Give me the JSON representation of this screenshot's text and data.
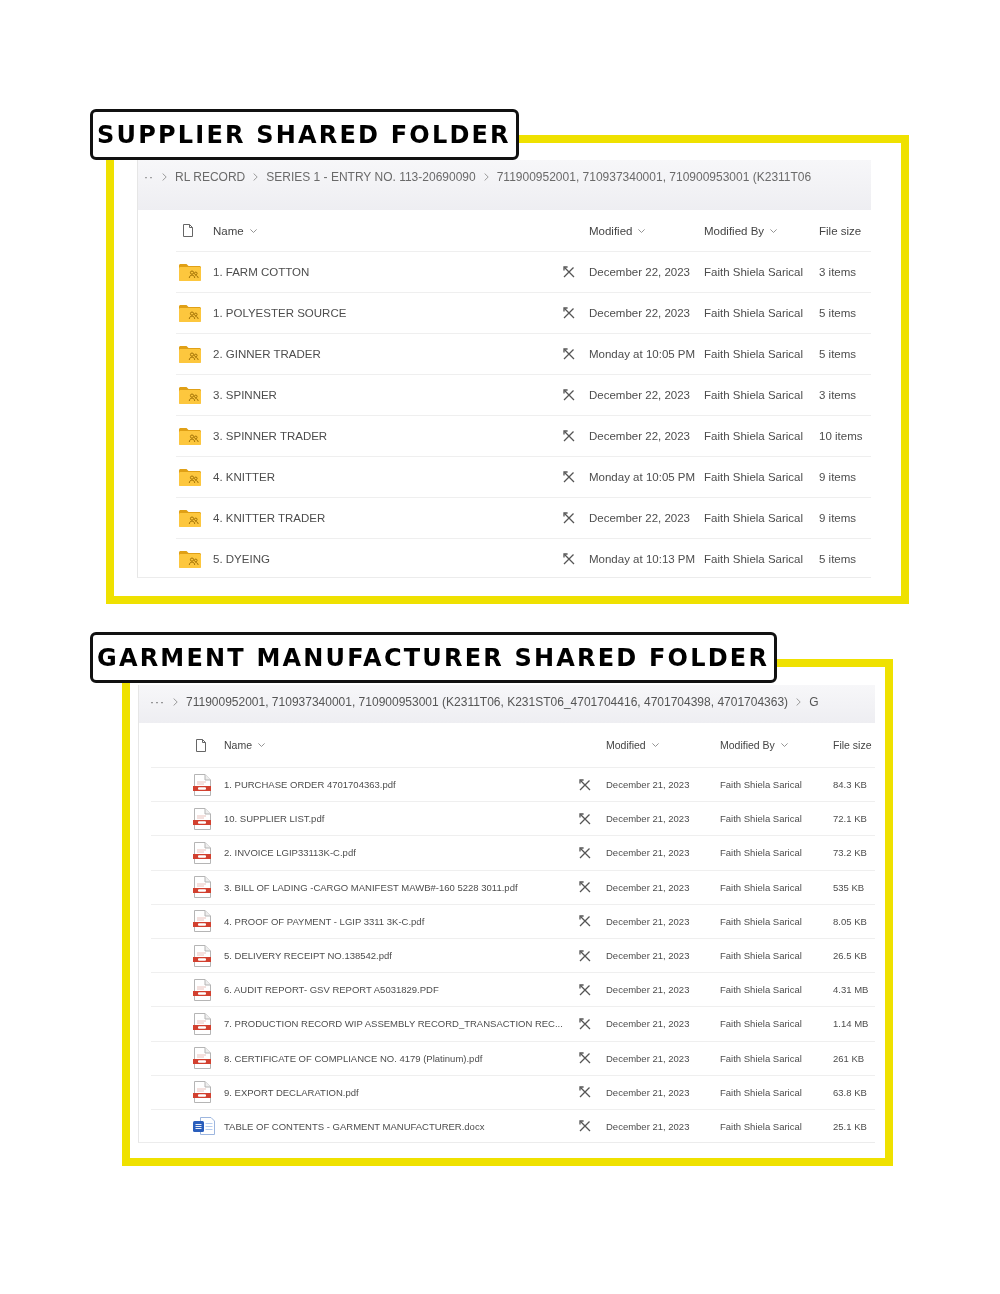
{
  "sections": [
    {
      "title": "SUPPLIER SHARED FOLDER",
      "breadcrumb": {
        "lead": "··",
        "items": [
          "RL RECORD",
          "SERIES 1 - ENTRY NO. 113-20690090",
          "711900952001, 710937340001, 710900953001 (K2311T06"
        ]
      },
      "columns": [
        {
          "label": "Name",
          "sortable": true
        },
        {
          "label": "Modified",
          "sortable": true
        },
        {
          "label": "Modified By",
          "sortable": true
        },
        {
          "label": "File size",
          "sortable": false
        }
      ],
      "rows": [
        {
          "kind": "folder",
          "name": "1. FARM COTTON",
          "modified": "December 22, 2023",
          "modified_by": "Faith Shiela Sarical",
          "size": "3 items"
        },
        {
          "kind": "folder",
          "name": "1. POLYESTER SOURCE",
          "modified": "December 22, 2023",
          "modified_by": "Faith Shiela Sarical",
          "size": "5 items"
        },
        {
          "kind": "folder",
          "name": "2. GINNER TRADER",
          "modified": "Monday at 10:05 PM",
          "modified_by": "Faith Shiela Sarical",
          "size": "5 items"
        },
        {
          "kind": "folder",
          "name": "3. SPINNER",
          "modified": "December 22, 2023",
          "modified_by": "Faith Shiela Sarical",
          "size": "3 items"
        },
        {
          "kind": "folder",
          "name": "3. SPINNER TRADER",
          "modified": "December 22, 2023",
          "modified_by": "Faith Shiela Sarical",
          "size": "10 items"
        },
        {
          "kind": "folder",
          "name": "4. KNITTER",
          "modified": "Monday at 10:05 PM",
          "modified_by": "Faith Shiela Sarical",
          "size": "9 items"
        },
        {
          "kind": "folder",
          "name": "4. KNITTER TRADER",
          "modified": "December 22, 2023",
          "modified_by": "Faith Shiela Sarical",
          "size": "9 items"
        },
        {
          "kind": "folder",
          "name": "5. DYEING",
          "modified": "Monday at 10:13 PM",
          "modified_by": "Faith Shiela Sarical",
          "size": "5 items"
        }
      ]
    },
    {
      "title": "GARMENT MANUFACTURER SHARED FOLDER",
      "breadcrumb": {
        "lead": "···",
        "items": [
          "711900952001, 710937340001, 710900953001 (K2311T06, K231ST06_4701704416, 4701704398, 4701704363)",
          "G"
        ]
      },
      "columns": [
        {
          "label": "Name",
          "sortable": true
        },
        {
          "label": "Modified",
          "sortable": true
        },
        {
          "label": "Modified By",
          "sortable": true
        },
        {
          "label": "File size",
          "sortable": false
        }
      ],
      "rows": [
        {
          "kind": "pdf",
          "name": "1. PURCHASE ORDER 4701704363.pdf",
          "modified": "December 21, 2023",
          "modified_by": "Faith Shiela Sarical",
          "size": "84.3 KB"
        },
        {
          "kind": "pdf",
          "name": "10. SUPPLIER LIST.pdf",
          "modified": "December 21, 2023",
          "modified_by": "Faith Shiela Sarical",
          "size": "72.1 KB"
        },
        {
          "kind": "pdf",
          "name": "2. INVOICE LGIP33113K-C.pdf",
          "modified": "December 21, 2023",
          "modified_by": "Faith Shiela Sarical",
          "size": "73.2 KB"
        },
        {
          "kind": "pdf",
          "name": "3. BILL OF LADING -CARGO MANIFEST MAWB#-160 5228 3011.pdf",
          "modified": "December 21, 2023",
          "modified_by": "Faith Shiela Sarical",
          "size": "535 KB"
        },
        {
          "kind": "pdf",
          "name": "4. PROOF OF PAYMENT - LGIP 3311 3K-C.pdf",
          "modified": "December 21, 2023",
          "modified_by": "Faith Shiela Sarical",
          "size": "8.05 KB"
        },
        {
          "kind": "pdf",
          "name": "5. DELIVERY RECEIPT NO.138542.pdf",
          "modified": "December 21, 2023",
          "modified_by": "Faith Shiela Sarical",
          "size": "26.5 KB"
        },
        {
          "kind": "pdf",
          "name": "6. AUDIT REPORT- GSV REPORT A5031829.PDF",
          "modified": "December 21, 2023",
          "modified_by": "Faith Shiela Sarical",
          "size": "4.31 MB"
        },
        {
          "kind": "pdf",
          "name": "7. PRODUCTION RECORD WIP ASSEMBLY RECORD_TRANSACTION REC...",
          "modified": "December 21, 2023",
          "modified_by": "Faith Shiela Sarical",
          "size": "1.14 MB"
        },
        {
          "kind": "pdf",
          "name": "8. CERTIFICATE OF COMPLIANCE NO. 4179 (Platinum).pdf",
          "modified": "December 21, 2023",
          "modified_by": "Faith Shiela Sarical",
          "size": "261 KB"
        },
        {
          "kind": "pdf",
          "name": "9. EXPORT DECLARATION.pdf",
          "modified": "December 21, 2023",
          "modified_by": "Faith Shiela Sarical",
          "size": "63.8 KB"
        },
        {
          "kind": "docx",
          "name": "TABLE OF CONTENTS - GARMENT MANUFACTURER.docx",
          "modified": "December 21, 2023",
          "modified_by": "Faith Shiela Sarical",
          "size": "25.1 KB"
        }
      ]
    }
  ]
}
